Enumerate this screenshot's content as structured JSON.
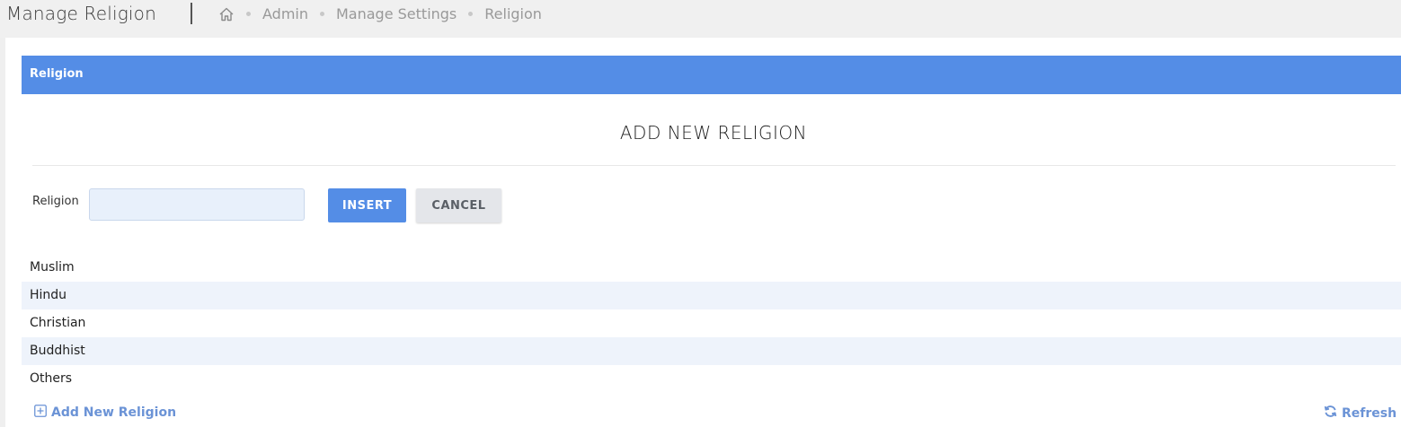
{
  "header": {
    "page_title": "Manage Religion",
    "breadcrumb": [
      "Admin",
      "Manage Settings",
      "Religion"
    ]
  },
  "panel": {
    "title": "Religion"
  },
  "form": {
    "heading": "ADD NEW RELIGION",
    "field_label": "Religion",
    "field_value": "",
    "insert_label": "INSERT",
    "cancel_label": "CANCEL"
  },
  "religions": [
    "Muslim",
    "Hindu",
    "Christian",
    "Buddhist",
    "Others"
  ],
  "footer": {
    "add_label": "Add New Religion",
    "refresh_label": "Refresh"
  },
  "colors": {
    "accent": "#548de6",
    "row_alt": "#eef3fb",
    "link": "#6b93d6"
  }
}
